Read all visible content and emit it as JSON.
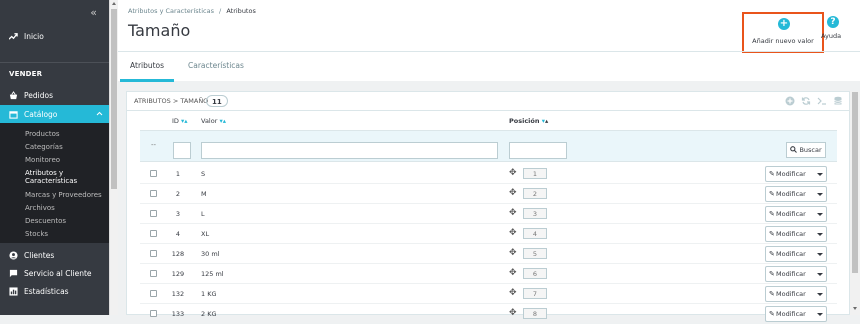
{
  "sidebar": {
    "collapse_glyph": "«",
    "top_item": {
      "label": "Inicio",
      "icon": "trending-up-icon"
    },
    "section_title": "VENDER",
    "items": [
      {
        "label": "Pedidos",
        "icon": "basket-icon"
      },
      {
        "label": "Catálogo",
        "icon": "store-icon",
        "active": true
      },
      {
        "label": "Clientes",
        "icon": "account-circle-icon"
      },
      {
        "label": "Servicio al Cliente",
        "icon": "chat-icon"
      },
      {
        "label": "Estadísticas",
        "icon": "chart-icon"
      }
    ],
    "catalog_sub": [
      "Productos",
      "Categorías",
      "Monitoreo",
      "Atributos y Características",
      "Marcas y Proveedores",
      "Archivos",
      "Descuentos",
      "Stocks"
    ]
  },
  "header": {
    "breadcrumb_parent": "Atributos y Características",
    "breadcrumb_sep": "/",
    "breadcrumb_current": "Atributos",
    "title": "Tamaño",
    "add_button": "Añadir nuevo valor",
    "help": "Ayuda",
    "tabs": [
      "Atributos",
      "Características"
    ]
  },
  "panel": {
    "heading": "ATRIBUTOS > TAMAÑO",
    "count": "11",
    "columns": {
      "id": "ID",
      "value": "Valor",
      "position": "Posición"
    },
    "filter_placeholder": "--",
    "search_button": "Buscar",
    "edit_label": "Modificar",
    "rows": [
      {
        "id": "1",
        "value": "S",
        "position": "1"
      },
      {
        "id": "2",
        "value": "M",
        "position": "2"
      },
      {
        "id": "3",
        "value": "L",
        "position": "3"
      },
      {
        "id": "4",
        "value": "XL",
        "position": "4"
      },
      {
        "id": "128",
        "value": "30 ml",
        "position": "5"
      },
      {
        "id": "129",
        "value": "125 ml",
        "position": "6"
      },
      {
        "id": "132",
        "value": "1 KG",
        "position": "7"
      },
      {
        "id": "133",
        "value": "2 KG",
        "position": "8"
      }
    ]
  },
  "colors": {
    "accent": "#25b9d7",
    "highlight_border": "#e9541b",
    "sidebar": "#363a41"
  }
}
